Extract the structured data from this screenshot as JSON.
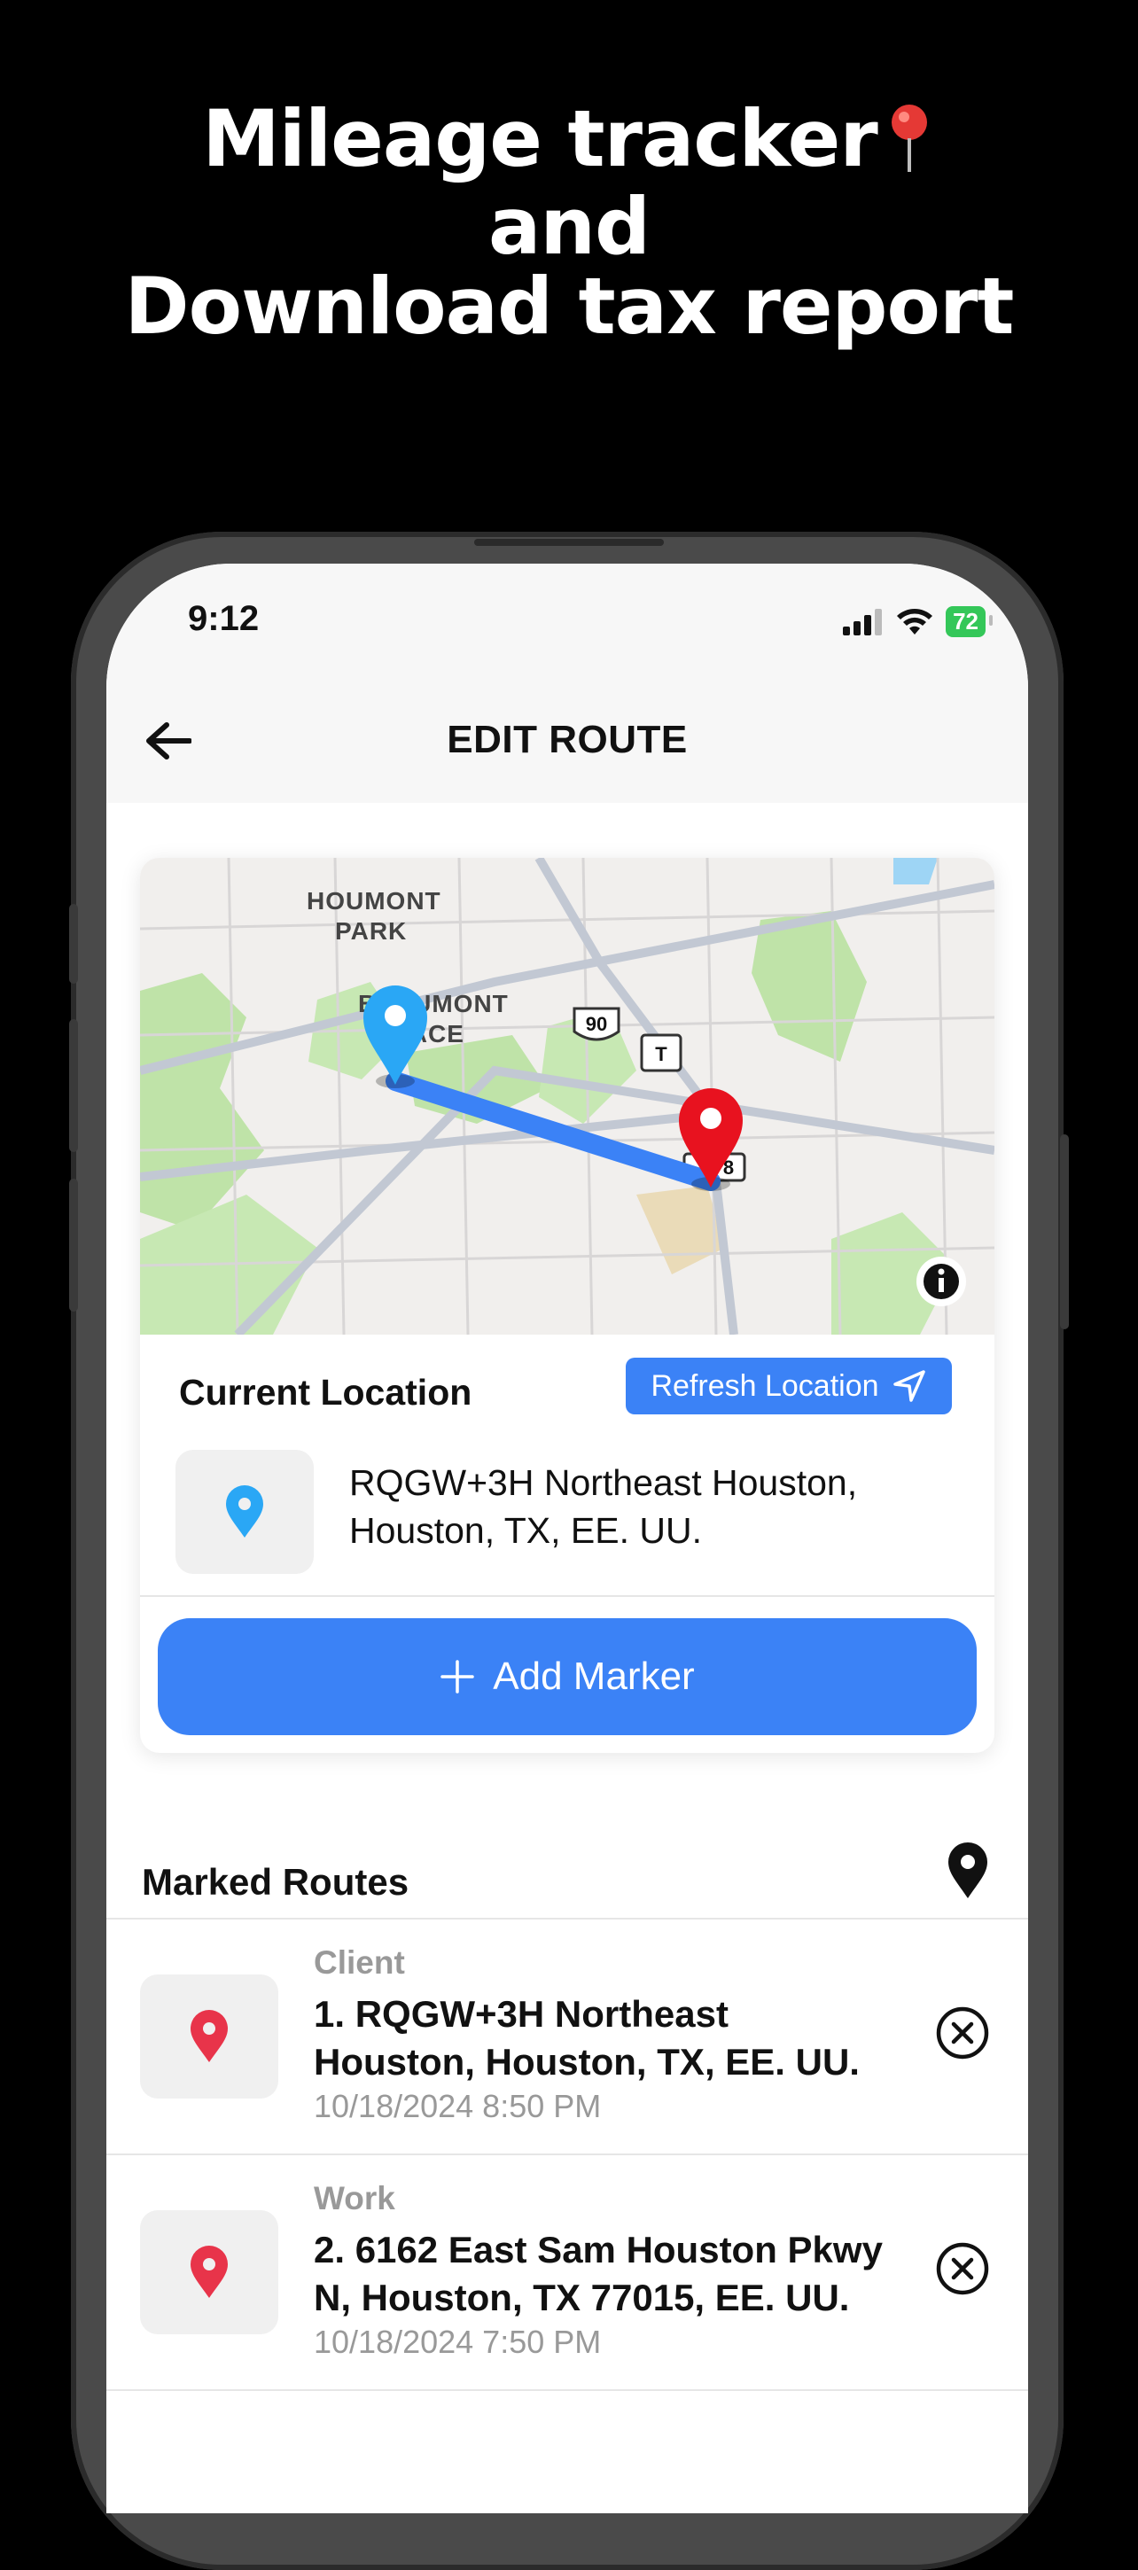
{
  "headline": {
    "line1": "Mileage tracker",
    "line2": "and",
    "line3": "Download tax report"
  },
  "status_bar": {
    "time": "9:12",
    "battery": "72"
  },
  "nav": {
    "title": "EDIT ROUTE"
  },
  "map": {
    "labels": [
      "HOUMONT",
      "PARK",
      "BEAUMONT",
      "PLACE"
    ],
    "shields": [
      "90",
      "T",
      "8"
    ],
    "info_icon": "info-icon"
  },
  "current_location": {
    "label": "Current Location",
    "refresh_label": "Refresh Location",
    "address_line1": "RQGW+3H Northeast Houston,",
    "address_line2": "Houston, TX, EE. UU."
  },
  "add_marker": {
    "label": "Add Marker"
  },
  "marked_routes": {
    "title": "Marked Routes",
    "items": [
      {
        "category": "Client",
        "address_line1": "1. RQGW+3H Northeast",
        "address_line2": "Houston, Houston, TX, EE. UU.",
        "timestamp": "10/18/2024 8:50 PM"
      },
      {
        "category": "Work",
        "address_line1": "2. 6162 East Sam Houston Pkwy",
        "address_line2": "N, Houston, TX 77015, EE. UU.",
        "timestamp": "10/18/2024 7:50 PM"
      }
    ]
  },
  "colors": {
    "accent": "#3b82f6",
    "pin_red": "#e8344a",
    "pin_blue": "#2aa7f5",
    "battery": "#34c759"
  }
}
